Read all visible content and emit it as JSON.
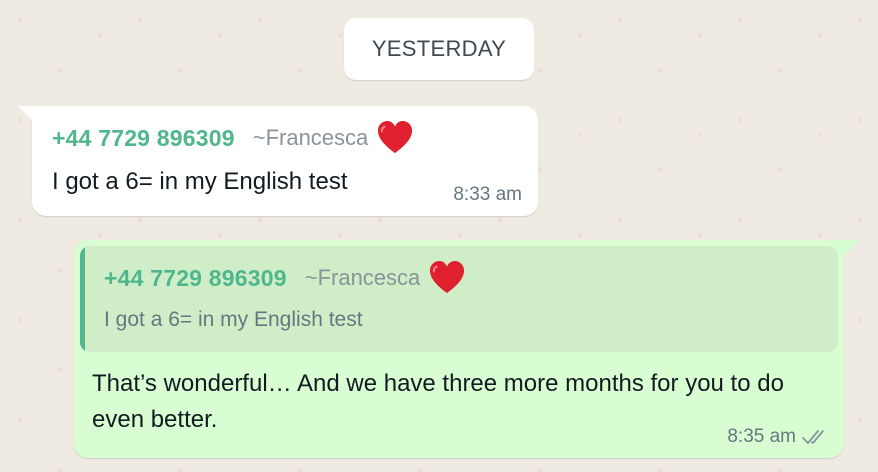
{
  "date_separator": {
    "label": "YESTERDAY"
  },
  "incoming_message": {
    "sender_phone": "+44 7729 896309",
    "sender_name": "~Francesca",
    "sender_emoji": "red-heart-icon",
    "text": "I got a 6= in my English test",
    "time": "8:33 am"
  },
  "outgoing_message": {
    "quoted": {
      "sender_phone": "+44 7729 896309",
      "sender_name": "~Francesca",
      "sender_emoji": "red-heart-icon",
      "text": "I got a 6= in my English test"
    },
    "text": "That’s wonderful… And we have three more months for you to do even better.",
    "time": "8:35 am",
    "status_icon": "double-check-icon"
  },
  "colors": {
    "chat_background": "#efeae2",
    "incoming_bubble": "#ffffff",
    "outgoing_bubble": "#d9fdd3",
    "quote_background": "#cfeec8",
    "sender_accent": "#4fb68d",
    "muted_text": "#667781",
    "heart": "#e0202f"
  }
}
